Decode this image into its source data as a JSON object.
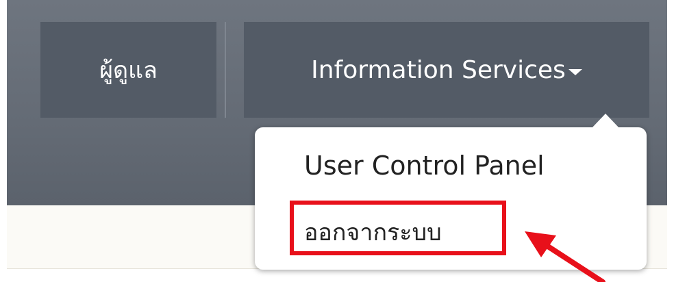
{
  "navbar": {
    "admin_label": "ผู้ดูแล",
    "info_services_label": "Information Services"
  },
  "dropdown": {
    "items": [
      {
        "label": "User Control Panel"
      },
      {
        "label": "ออกจากระบบ"
      }
    ]
  },
  "annotation": {
    "highlight_color": "#e8101a",
    "arrow_color": "#e8101a"
  },
  "colors": {
    "navbar_bg": "#646b75",
    "nav_button_bg": "#535b66",
    "dropdown_bg": "#ffffff"
  }
}
